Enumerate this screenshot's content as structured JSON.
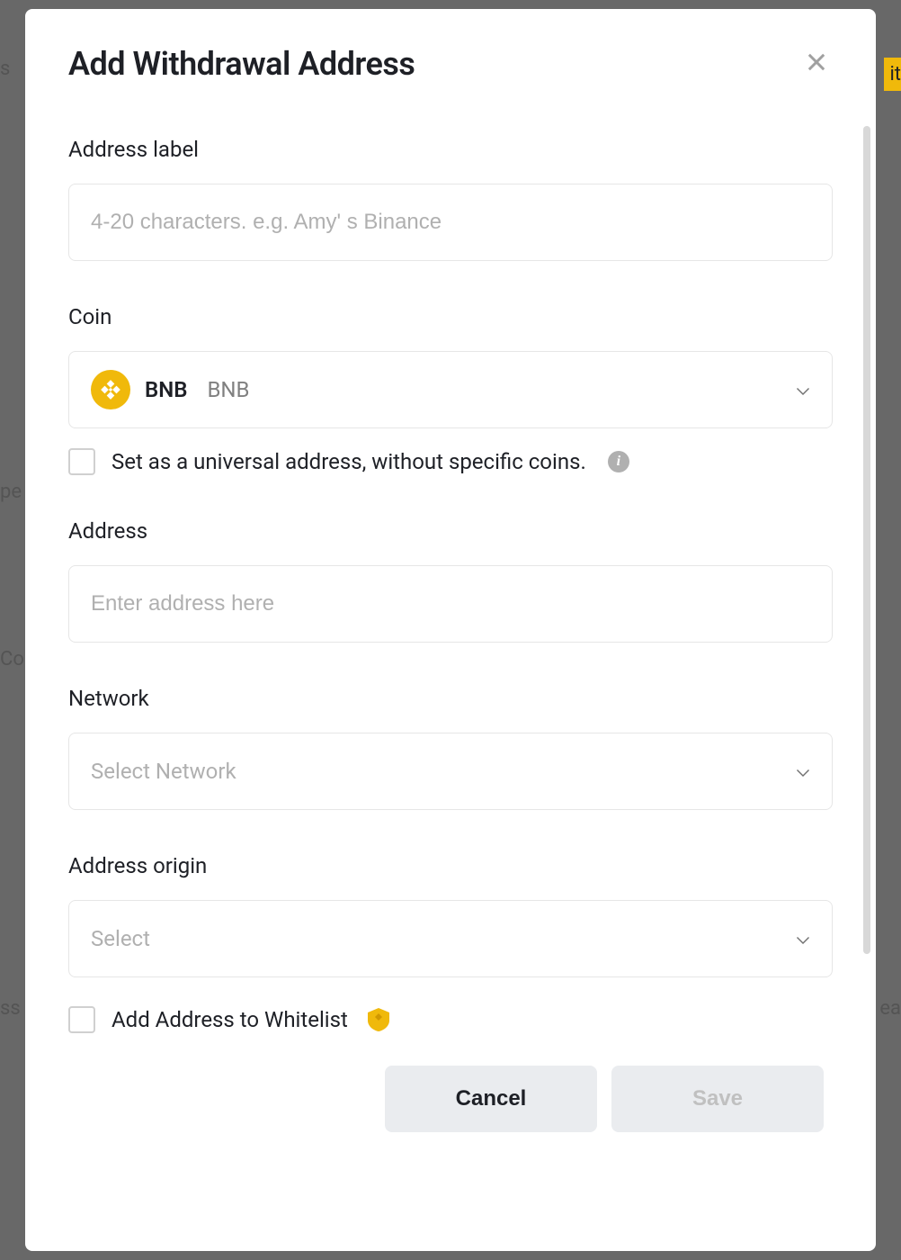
{
  "modal": {
    "title": "Add Withdrawal Address",
    "fields": {
      "address_label": {
        "label": "Address label",
        "placeholder": "4-20 characters. e.g. Amy' s Binance"
      },
      "coin": {
        "label": "Coin",
        "selected_symbol": "BNB",
        "selected_name": "BNB"
      },
      "universal_checkbox": {
        "label": "Set as a universal address, without specific coins."
      },
      "address": {
        "label": "Address",
        "placeholder": "Enter address here"
      },
      "network": {
        "label": "Network",
        "placeholder": "Select Network"
      },
      "address_origin": {
        "label": "Address origin",
        "placeholder": "Select"
      },
      "whitelist_checkbox": {
        "label": "Add Address to Whitelist"
      }
    },
    "buttons": {
      "cancel": "Cancel",
      "save": "Save"
    }
  }
}
